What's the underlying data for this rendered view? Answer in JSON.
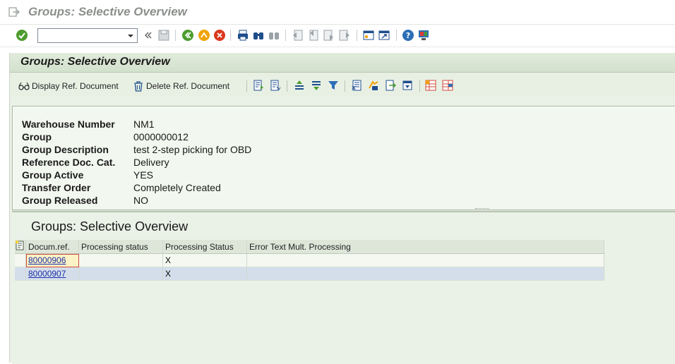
{
  "window": {
    "title": "Groups: Selective Overview"
  },
  "system_toolbar": {
    "command_field": {
      "value": "",
      "placeholder": ""
    },
    "icons": [
      "enter-icon",
      "command-dropdown-icon",
      "collapse-icon",
      "save-icon",
      "back-icon",
      "exit-icon",
      "cancel-icon",
      "print-icon",
      "find-icon",
      "find-next-icon",
      "first-page-icon",
      "previous-page-icon",
      "next-page-icon",
      "last-page-icon",
      "create-session-icon",
      "shortcut-icon",
      "help-icon",
      "customize-layout-icon"
    ]
  },
  "panel": {
    "title": "Groups: Selective Overview",
    "toolbar": {
      "display_ref_doc": "Display Ref. Document",
      "delete_ref_doc": "Delete Ref. Document"
    }
  },
  "header": {
    "fields": [
      {
        "label": "Warehouse Number",
        "value": "NM1"
      },
      {
        "label": "Group",
        "value": "0000000012"
      },
      {
        "label": "Group Description",
        "value": "test 2-step picking for OBD"
      },
      {
        "label": "Reference Doc. Cat.",
        "value": "Delivery"
      },
      {
        "label": "Group Active",
        "value": "YES"
      },
      {
        "label": "Transfer Order",
        "value": "Completely Created"
      },
      {
        "label": "Group Released",
        "value": "NO"
      }
    ]
  },
  "alv": {
    "title": "Groups: Selective Overview",
    "columns": [
      "Docum.ref.",
      "Processing status",
      "Processing Status",
      "Error Text Mult. Processing"
    ],
    "rows": [
      {
        "docref": "80000906",
        "proc_status": "",
        "proc_status2": "X",
        "error_text": ""
      },
      {
        "docref": "80000907",
        "proc_status": "",
        "proc_status2": "X",
        "error_text": ""
      }
    ]
  },
  "colors": {
    "panel_bg": "#eaf1e6",
    "header_bg": "#f2f7ef",
    "link": "#1b2fa6",
    "selected_row": "#d4deeb"
  }
}
